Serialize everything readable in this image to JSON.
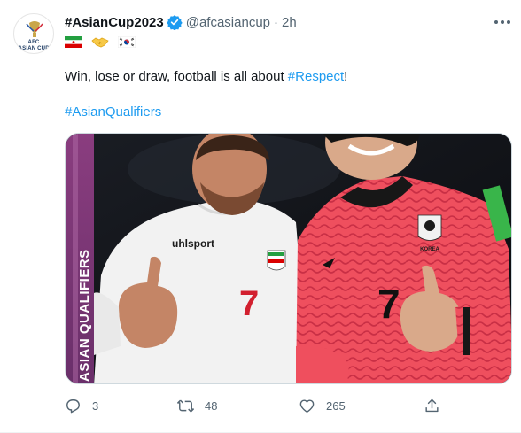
{
  "tweet": {
    "account_name": "#AsianCup2023",
    "handle": "@afcasiancup",
    "separator": "·",
    "time": "2h",
    "avatar_text_top": "AFC",
    "avatar_text_bottom": "ASIAN CUP",
    "flags": [
      "iran-flag",
      "handshake-emoji",
      "south-korea-flag"
    ],
    "text_before": "Win, lose or draw, football is all about ",
    "text_hashtag": "#Respect",
    "text_after": "!",
    "hashtag_line": "#AsianQualifiers",
    "media": {
      "banner_text": "ASIAN QUALIFIERS",
      "jersey_brand": "uhlsport",
      "left_jersey_number": "7",
      "right_jersey_number": "7",
      "right_crest_text": "KOREA"
    },
    "actions": {
      "reply_count": "3",
      "retweet_count": "48",
      "like_count": "265"
    }
  },
  "colors": {
    "link": "#1d9bf0",
    "muted": "#536471",
    "verified": "#1d9bf0"
  }
}
